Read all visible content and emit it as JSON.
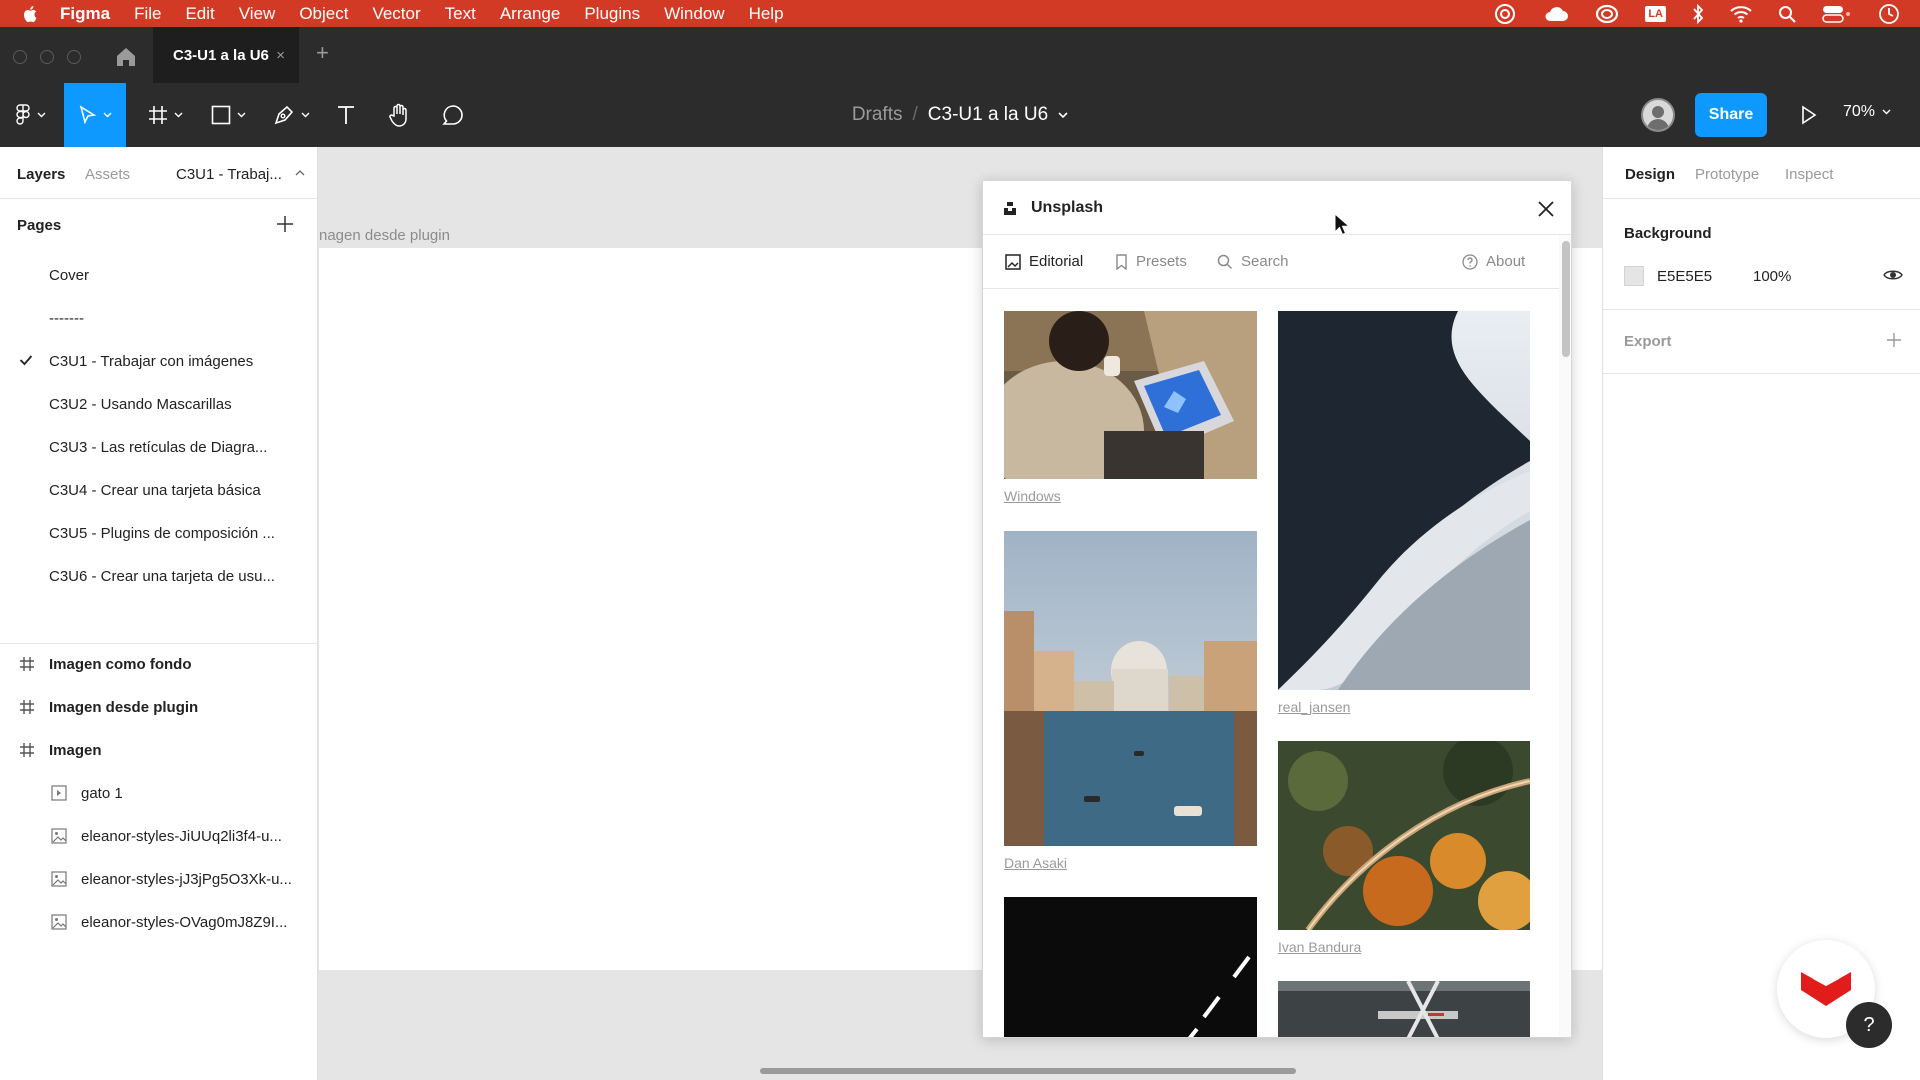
{
  "menubar": {
    "app_name": "Figma",
    "items": [
      "File",
      "Edit",
      "View",
      "Object",
      "Vector",
      "Text",
      "Arrange",
      "Plugins",
      "Window",
      "Help"
    ],
    "status_icons": [
      "creative-cloud-icon",
      "cloud-icon",
      "adobe-icon",
      "la-icon",
      "bluetooth-icon",
      "wifi-icon",
      "spotlight-icon",
      "control-center-icon",
      "clock-icon"
    ],
    "la_badge": "LA",
    "bg_color": "#d23a25"
  },
  "tabbar": {
    "file_tab": "C3-U1 a la U6",
    "close_glyph": "×",
    "new_tab_glyph": "+"
  },
  "toolbar": {
    "breadcrumb_root": "Drafts",
    "breadcrumb_sep": "/",
    "breadcrumb_file": "C3-U1 a la U6",
    "share_label": "Share",
    "zoom": "70%",
    "accent": "#0d99ff"
  },
  "left_panel": {
    "tabs": [
      "Layers",
      "Assets"
    ],
    "page_selector": "C3U1 - Trabaj...",
    "pages_header": "Pages",
    "pages": [
      {
        "label": "Cover",
        "current": false
      },
      {
        "label": "-------",
        "current": false
      },
      {
        "label": "C3U1 - Trabajar con imágenes",
        "current": true
      },
      {
        "label": "C3U2 - Usando Mascarillas",
        "current": false
      },
      {
        "label": "C3U3 - Las retículas de Diagra...",
        "current": false
      },
      {
        "label": "C3U4 - Crear una tarjeta básica",
        "current": false
      },
      {
        "label": "C3U5 - Plugins de composición ...",
        "current": false
      },
      {
        "label": "C3U6 - Crear una tarjeta de usu...",
        "current": false
      }
    ],
    "layers": [
      {
        "label": "Imagen como fondo",
        "kind": "frame"
      },
      {
        "label": "Imagen desde plugin",
        "kind": "frame"
      },
      {
        "label": "Imagen",
        "kind": "frame"
      },
      {
        "label": "gato 1",
        "kind": "component"
      },
      {
        "label": "eleanor-styles-JiUUq2li3f4-u...",
        "kind": "image"
      },
      {
        "label": "eleanor-styles-jJ3jPg5O3Xk-u...",
        "kind": "image"
      },
      {
        "label": "eleanor-styles-OVag0mJ8Z9I...",
        "kind": "image"
      }
    ]
  },
  "canvas": {
    "frame_label": "nagen desde plugin",
    "bg_color": "#e5e5e5"
  },
  "plugin": {
    "title": "Unsplash",
    "nav": {
      "editorial": "Editorial",
      "presets": "Presets",
      "search": "Search",
      "about": "About"
    },
    "photos": [
      {
        "credit": "Windows"
      },
      {
        "credit": "real_jansen"
      },
      {
        "credit": "Dan Asaki"
      },
      {
        "credit": "Ivan Bandura"
      },
      {
        "credit": ""
      },
      {
        "credit": ""
      }
    ]
  },
  "right_panel": {
    "tabs": [
      "Design",
      "Prototype",
      "Inspect"
    ],
    "background_label": "Background",
    "background_hex": "E5E5E5",
    "background_opacity": "100%",
    "export_label": "Export"
  },
  "help_glyph": "?"
}
